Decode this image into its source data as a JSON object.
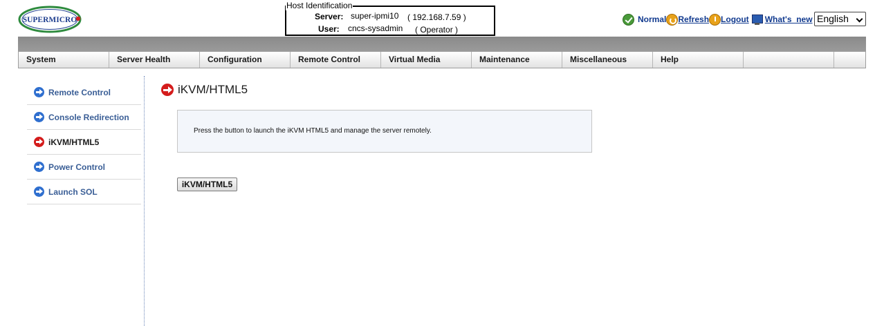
{
  "brand": {
    "logo_text": "SUPERMICRO"
  },
  "host": {
    "legend": "Host Identification",
    "server_label": "Server:",
    "server_value": "super-ipmi10",
    "server_ip": "( 192.168.7.59 )",
    "user_label": "User:",
    "user_value": "cncs-sysadmin",
    "user_role": "( Operator )"
  },
  "toolbar": {
    "status_text": "Normal",
    "refresh_label": "Refresh",
    "logout_label": "Logout",
    "whats_new_label": "What's_new",
    "language_value": "English"
  },
  "menu": {
    "items": [
      {
        "label": "System"
      },
      {
        "label": "Server Health"
      },
      {
        "label": "Configuration"
      },
      {
        "label": "Remote Control"
      },
      {
        "label": "Virtual Media"
      },
      {
        "label": "Maintenance"
      },
      {
        "label": "Miscellaneous"
      },
      {
        "label": "Help"
      },
      {
        "label": ""
      }
    ]
  },
  "sidebar": {
    "items": [
      {
        "label": "Remote Control"
      },
      {
        "label": "Console Redirection"
      },
      {
        "label": "iKVM/HTML5",
        "active": true
      },
      {
        "label": "Power Control"
      },
      {
        "label": "Launch SOL"
      }
    ]
  },
  "main": {
    "title": "iKVM/HTML5",
    "info_text": "Press the button to launch the iKVM HTML5 and manage the server remotely.",
    "button_label": "iKVM/HTML5"
  },
  "colors": {
    "accent_link": "#113a8f",
    "sidebar_link": "#3a5e96",
    "active_arrow": "#d41c1c",
    "nav_arrow": "#2f6fcf"
  }
}
